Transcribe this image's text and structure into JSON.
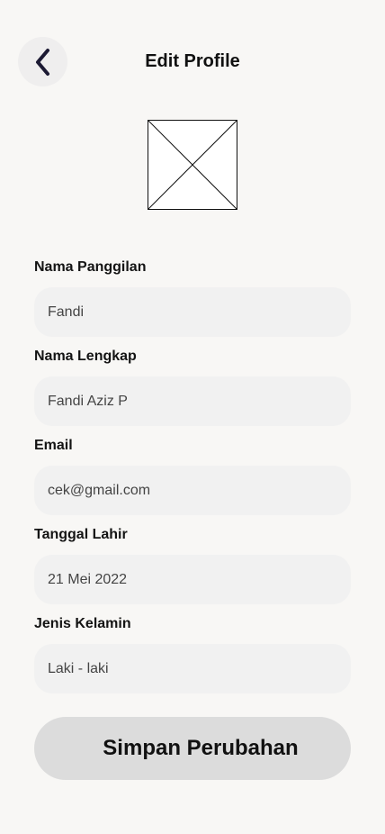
{
  "header": {
    "title": "Edit Profile",
    "back_icon": "chevron-left-icon"
  },
  "avatar": {
    "icon": "image-placeholder-icon"
  },
  "form": {
    "fields": [
      {
        "label": "Nama Panggilan",
        "value": "Fandi"
      },
      {
        "label": "Nama Lengkap",
        "value": "Fandi Aziz P"
      },
      {
        "label": "Email",
        "value": "cek@gmail.com"
      },
      {
        "label": "Tanggal Lahir",
        "value": "21 Mei 2022"
      },
      {
        "label": "Jenis Kelamin",
        "value": "Laki - laki"
      }
    ],
    "save_label": "Simpan Perubahan"
  },
  "colors": {
    "background": "#f8f7f5",
    "field_background": "#f1f1f1",
    "button_background": "#dcdcdc",
    "back_button_background": "#efeeee",
    "chevron": "#1c1a33"
  }
}
